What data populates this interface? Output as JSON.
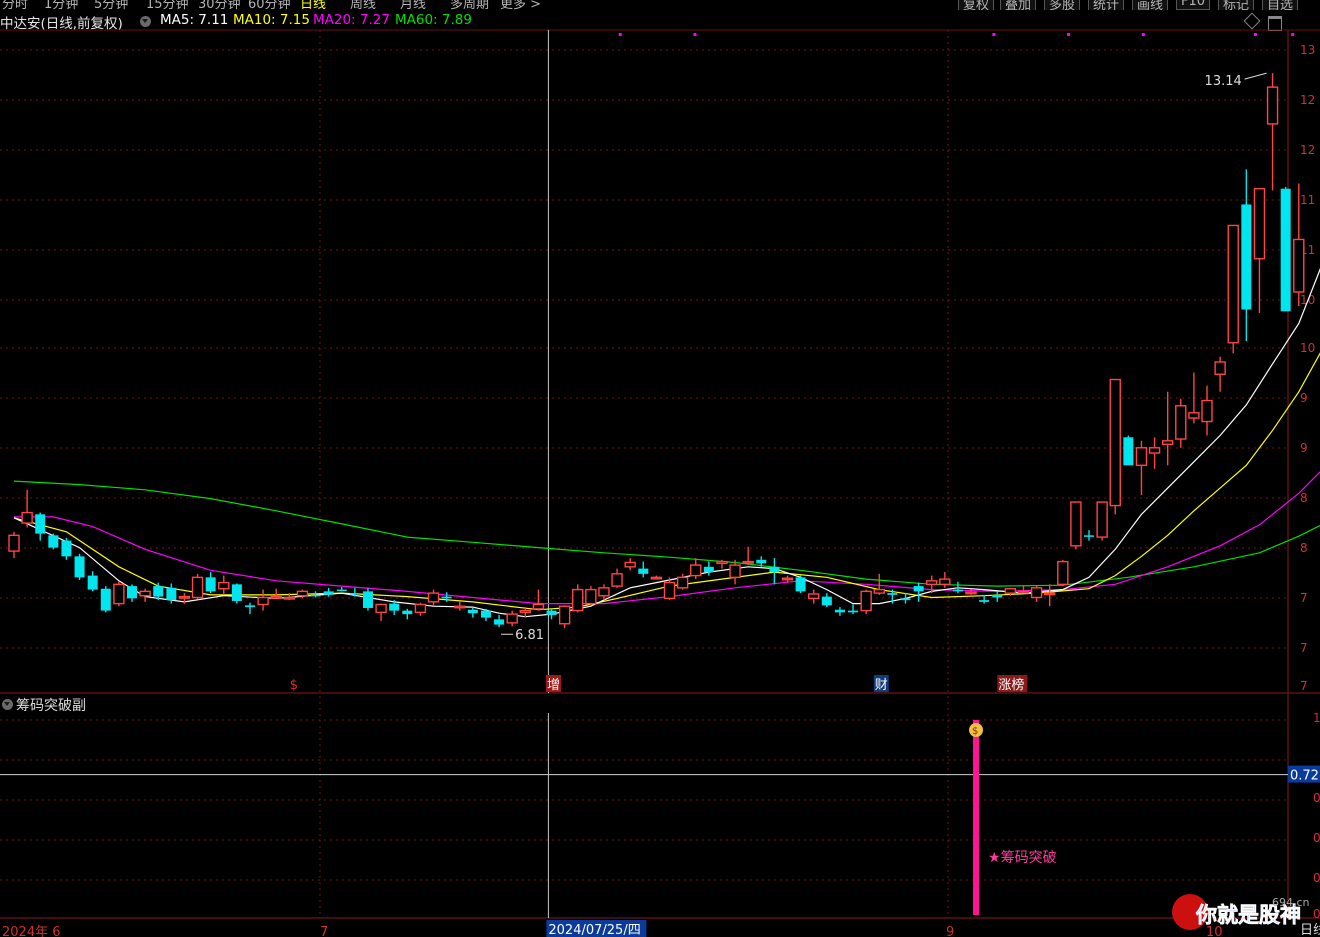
{
  "toolbar": {
    "period_tabs": [
      "分时",
      "1分钟",
      "5分钟",
      "15分钟",
      "30分钟",
      "60分钟",
      "日线",
      "周线",
      "月线",
      "多周期",
      "更多 >"
    ],
    "active_tab": "日线",
    "right_buttons": [
      "复权",
      "叠加",
      "多股",
      "统计",
      "画线",
      "F10",
      "标记",
      "自选"
    ]
  },
  "header": {
    "stock_name": "中达安(日线,前复权)",
    "ma_items": [
      {
        "label": "MA5: 7.11",
        "color": "#ffffff"
      },
      {
        "label": "MA10: 7.15",
        "color": "#ffff00"
      },
      {
        "label": "MA20: 7.27",
        "color": "#ff00ff"
      },
      {
        "label": "MA60: 7.89",
        "color": "#00e000"
      }
    ]
  },
  "main_price_axis_labels": [
    "13",
    "12",
    "12",
    "11",
    "11",
    "10",
    "10",
    "9",
    "9",
    "8",
    "8",
    "7",
    "7",
    "7"
  ],
  "markers": [
    {
      "text": "$",
      "color": "#e03030",
      "bg": "#000000"
    },
    {
      "text": "增",
      "color": "#ffffff",
      "bg": "#a01818"
    },
    {
      "text": "财",
      "color": "#ffffff",
      "bg": "#103a7a"
    },
    {
      "text": "涨榜",
      "color": "#ffffff",
      "bg": "#8a1a1a"
    }
  ],
  "annotations": {
    "high": "13.14",
    "low": "6.81"
  },
  "sub_indicator": {
    "title": "筹码突破副",
    "signal_label": "★筹码突破",
    "crosshair_value": "0.72",
    "axis_labels": [
      "1",
      "0",
      "0",
      "0",
      "0"
    ]
  },
  "date_axis": {
    "labels": [
      "2024年 6",
      "7",
      "9",
      "10"
    ],
    "crosshair_date": "2024/07/25/四",
    "right_label": "日线"
  },
  "watermark": {
    "text": "你就是股神",
    "site": "694.cn"
  },
  "colors": {
    "up": "#ff4444",
    "down": "#00e5ee",
    "ma5": "#ffffff",
    "ma10": "#ffff00",
    "ma20": "#ff00ff",
    "ma60": "#00e000",
    "signal_bar": "#ff1493",
    "grid": "#7a1010"
  },
  "chart_data": {
    "type": "candlestick",
    "title": "中达安(日线,前复权)",
    "ylim": [
      6.55,
      13.45
    ],
    "candles_ohlc": [
      [
        7.68,
        7.9,
        7.6,
        7.86
      ],
      [
        8.0,
        8.38,
        7.95,
        8.12
      ],
      [
        8.1,
        8.12,
        7.8,
        7.88
      ],
      [
        7.86,
        7.88,
        7.7,
        7.72
      ],
      [
        7.8,
        7.83,
        7.58,
        7.62
      ],
      [
        7.62,
        7.65,
        7.35,
        7.38
      ],
      [
        7.4,
        7.45,
        7.22,
        7.24
      ],
      [
        7.25,
        7.28,
        6.98,
        7.0
      ],
      [
        7.08,
        7.33,
        7.05,
        7.3
      ],
      [
        7.28,
        7.3,
        7.1,
        7.14
      ],
      [
        7.17,
        7.25,
        7.1,
        7.22
      ],
      [
        7.28,
        7.32,
        7.12,
        7.16
      ],
      [
        7.26,
        7.31,
        7.08,
        7.12
      ],
      [
        7.15,
        7.2,
        7.08,
        7.16
      ],
      [
        7.15,
        7.42,
        7.13,
        7.38
      ],
      [
        7.38,
        7.44,
        7.2,
        7.22
      ],
      [
        7.25,
        7.4,
        7.18,
        7.32
      ],
      [
        7.3,
        7.31,
        7.08,
        7.11
      ],
      [
        7.06,
        7.09,
        6.96,
        7.04
      ],
      [
        7.07,
        7.24,
        7.0,
        7.15
      ],
      [
        7.15,
        7.25,
        7.14,
        7.16
      ],
      [
        7.14,
        7.2,
        7.12,
        7.15
      ],
      [
        7.17,
        7.24,
        7.14,
        7.22
      ],
      [
        7.18,
        7.22,
        7.15,
        7.17
      ],
      [
        7.22,
        7.26,
        7.16,
        7.18
      ],
      [
        7.24,
        7.27,
        7.22,
        7.23
      ],
      [
        7.2,
        7.26,
        7.16,
        7.19
      ],
      [
        7.22,
        7.26,
        7.0,
        7.03
      ],
      [
        6.98,
        7.08,
        6.88,
        7.07
      ],
      [
        7.08,
        7.12,
        6.95,
        7.0
      ],
      [
        7.0,
        7.02,
        6.9,
        6.96
      ],
      [
        6.98,
        7.09,
        6.94,
        7.07
      ],
      [
        7.1,
        7.24,
        7.06,
        7.2
      ],
      [
        7.16,
        7.21,
        7.1,
        7.14
      ],
      [
        7.04,
        7.1,
        7.0,
        7.05
      ],
      [
        7.01,
        7.04,
        6.92,
        6.97
      ],
      [
        7.0,
        7.02,
        6.88,
        6.92
      ],
      [
        6.9,
        6.95,
        6.81,
        6.84
      ],
      [
        6.86,
        7.0,
        6.82,
        6.96
      ],
      [
        6.98,
        7.04,
        6.92,
        7.0
      ],
      [
        7.02,
        7.24,
        7.0,
        7.07
      ],
      [
        7.0,
        7.03,
        6.9,
        6.95
      ],
      [
        6.85,
        7.06,
        6.8,
        7.05
      ],
      [
        7.0,
        7.3,
        6.98,
        7.24
      ],
      [
        7.08,
        7.28,
        7.06,
        7.24
      ],
      [
        7.17,
        7.3,
        7.12,
        7.26
      ],
      [
        7.28,
        7.48,
        7.26,
        7.42
      ],
      [
        7.5,
        7.6,
        7.46,
        7.55
      ],
      [
        7.48,
        7.56,
        7.38,
        7.42
      ],
      [
        7.38,
        7.4,
        7.36,
        7.38
      ],
      [
        7.14,
        7.38,
        7.12,
        7.32
      ],
      [
        7.26,
        7.42,
        7.24,
        7.38
      ],
      [
        7.4,
        7.6,
        7.36,
        7.52
      ],
      [
        7.5,
        7.56,
        7.4,
        7.44
      ],
      [
        7.54,
        7.58,
        7.48,
        7.56
      ],
      [
        7.38,
        7.58,
        7.3,
        7.52
      ],
      [
        7.56,
        7.73,
        7.52,
        7.56
      ],
      [
        7.58,
        7.62,
        7.5,
        7.54
      ],
      [
        7.5,
        7.6,
        7.3,
        7.44
      ],
      [
        7.36,
        7.4,
        7.32,
        7.37
      ],
      [
        7.38,
        7.4,
        7.2,
        7.22
      ],
      [
        7.14,
        7.24,
        7.08,
        7.19
      ],
      [
        7.16,
        7.2,
        7.04,
        7.06
      ],
      [
        7.01,
        7.04,
        6.94,
        6.98
      ],
      [
        7.0,
        7.07,
        6.96,
        6.98
      ],
      [
        7.0,
        7.24,
        6.96,
        7.22
      ],
      [
        7.2,
        7.42,
        7.18,
        7.24
      ],
      [
        7.2,
        7.24,
        7.08,
        7.18
      ],
      [
        7.14,
        7.2,
        7.08,
        7.12
      ],
      [
        7.28,
        7.32,
        7.1,
        7.22
      ],
      [
        7.3,
        7.4,
        7.2,
        7.34
      ],
      [
        7.3,
        7.44,
        7.26,
        7.36
      ],
      [
        7.24,
        7.33,
        7.2,
        7.22
      ],
      [
        7.2,
        7.24,
        7.18,
        7.21
      ],
      [
        7.12,
        7.18,
        7.08,
        7.1
      ],
      [
        7.18,
        7.22,
        7.1,
        7.15
      ],
      [
        7.2,
        7.26,
        7.17,
        7.25
      ],
      [
        7.22,
        7.28,
        7.2,
        7.22
      ],
      [
        7.15,
        7.28,
        7.1,
        7.26
      ],
      [
        7.2,
        7.3,
        7.05,
        7.2
      ],
      [
        7.3,
        7.58,
        7.28,
        7.56
      ],
      [
        7.74,
        8.24,
        7.7,
        8.24
      ],
      [
        7.86,
        7.92,
        7.8,
        7.85
      ],
      [
        7.84,
        8.06,
        7.8,
        8.24
      ],
      [
        8.2,
        9.42,
        8.1,
        9.64
      ],
      [
        8.98,
        9.0,
        8.66,
        8.66
      ],
      [
        8.66,
        8.94,
        8.32,
        8.86
      ],
      [
        8.8,
        8.98,
        8.62,
        8.86
      ],
      [
        8.9,
        9.5,
        8.66,
        8.94
      ],
      [
        8.96,
        9.42,
        8.86,
        9.34
      ],
      [
        9.2,
        9.72,
        9.14,
        9.26
      ],
      [
        9.16,
        9.57,
        9.0,
        9.4
      ],
      [
        9.7,
        9.9,
        9.5,
        9.84
      ],
      [
        10.06,
        11.4,
        9.94,
        11.4
      ],
      [
        11.64,
        12.04,
        10.08,
        10.44
      ],
      [
        11.02,
        11.8,
        10.4,
        11.82
      ],
      [
        12.56,
        13.14,
        11.8,
        12.98
      ],
      [
        11.82,
        11.84,
        10.44,
        10.42
      ],
      [
        10.64,
        11.88,
        10.48,
        11.24
      ]
    ],
    "ma5": [
      [
        0,
        8.06
      ],
      [
        5,
        7.72
      ],
      [
        8,
        7.34
      ],
      [
        10,
        7.16
      ],
      [
        13,
        7.1
      ],
      [
        16,
        7.17
      ],
      [
        20,
        7.14
      ],
      [
        25,
        7.2
      ],
      [
        29,
        7.1
      ],
      [
        32,
        7.05
      ],
      [
        35,
        7.04
      ],
      [
        37,
        6.97
      ],
      [
        39,
        6.93
      ],
      [
        41,
        6.96
      ],
      [
        44,
        7.05
      ],
      [
        47,
        7.26
      ],
      [
        50,
        7.35
      ],
      [
        53,
        7.44
      ],
      [
        56,
        7.5
      ],
      [
        58,
        7.48
      ],
      [
        60,
        7.38
      ],
      [
        62,
        7.24
      ],
      [
        64,
        7.08
      ],
      [
        66,
        7.08
      ],
      [
        68,
        7.14
      ],
      [
        70,
        7.22
      ],
      [
        72,
        7.26
      ],
      [
        74,
        7.24
      ],
      [
        77,
        7.2
      ],
      [
        80,
        7.24
      ],
      [
        82,
        7.38
      ],
      [
        84,
        7.7
      ],
      [
        86,
        8.1
      ],
      [
        88,
        8.4
      ],
      [
        90,
        8.7
      ],
      [
        92,
        9.0
      ],
      [
        94,
        9.35
      ],
      [
        96,
        9.82
      ],
      [
        98,
        10.28
      ],
      [
        100,
        11.04
      ]
    ],
    "ma10": [
      [
        0,
        8.06
      ],
      [
        4,
        7.9
      ],
      [
        8,
        7.5
      ],
      [
        11,
        7.28
      ],
      [
        15,
        7.18
      ],
      [
        20,
        7.18
      ],
      [
        25,
        7.2
      ],
      [
        30,
        7.16
      ],
      [
        35,
        7.1
      ],
      [
        40,
        7.01
      ],
      [
        43,
        7.04
      ],
      [
        46,
        7.14
      ],
      [
        50,
        7.28
      ],
      [
        54,
        7.36
      ],
      [
        58,
        7.44
      ],
      [
        62,
        7.38
      ],
      [
        66,
        7.24
      ],
      [
        70,
        7.15
      ],
      [
        74,
        7.17
      ],
      [
        78,
        7.2
      ],
      [
        82,
        7.25
      ],
      [
        84,
        7.4
      ],
      [
        86,
        7.62
      ],
      [
        88,
        7.86
      ],
      [
        90,
        8.14
      ],
      [
        92,
        8.4
      ],
      [
        94,
        8.66
      ],
      [
        96,
        9.06
      ],
      [
        98,
        9.5
      ],
      [
        100,
        10.04
      ]
    ],
    "ma20": [
      [
        0,
        8.07
      ],
      [
        3,
        8.07
      ],
      [
        6,
        7.96
      ],
      [
        10,
        7.7
      ],
      [
        15,
        7.46
      ],
      [
        20,
        7.34
      ],
      [
        25,
        7.28
      ],
      [
        30,
        7.22
      ],
      [
        35,
        7.15
      ],
      [
        40,
        7.08
      ],
      [
        45,
        7.08
      ],
      [
        50,
        7.16
      ],
      [
        55,
        7.26
      ],
      [
        60,
        7.34
      ],
      [
        65,
        7.3
      ],
      [
        70,
        7.24
      ],
      [
        75,
        7.22
      ],
      [
        80,
        7.24
      ],
      [
        84,
        7.3
      ],
      [
        88,
        7.5
      ],
      [
        92,
        7.74
      ],
      [
        95,
        7.98
      ],
      [
        98,
        8.34
      ],
      [
        100,
        8.64
      ]
    ],
    "ma60": [
      [
        0,
        8.48
      ],
      [
        5,
        8.44
      ],
      [
        10,
        8.38
      ],
      [
        15,
        8.28
      ],
      [
        20,
        8.14
      ],
      [
        25,
        7.99
      ],
      [
        30,
        7.84
      ],
      [
        35,
        7.78
      ],
      [
        40,
        7.72
      ],
      [
        45,
        7.66
      ],
      [
        50,
        7.61
      ],
      [
        55,
        7.55
      ],
      [
        60,
        7.46
      ],
      [
        65,
        7.36
      ],
      [
        70,
        7.3
      ],
      [
        75,
        7.28
      ],
      [
        80,
        7.29
      ],
      [
        85,
        7.38
      ],
      [
        90,
        7.5
      ],
      [
        95,
        7.66
      ],
      [
        98,
        7.85
      ],
      [
        100,
        8.0
      ]
    ],
    "marker_candle_index": [
      21,
      41,
      66,
      76
    ],
    "signal_candle_index": 73,
    "crosshair_candle_index": 40,
    "signal_value": 1,
    "crosshair_sub_value": 0.72
  }
}
